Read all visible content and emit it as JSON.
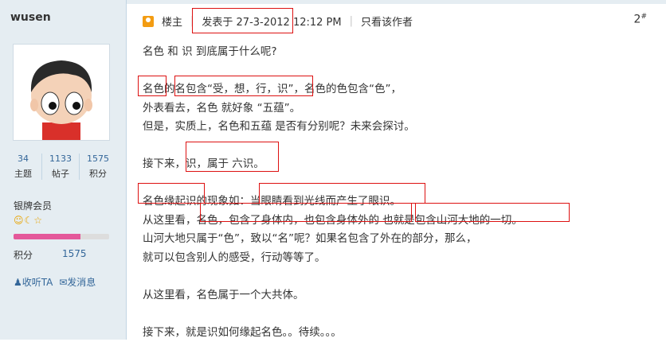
{
  "user": {
    "name": "wusen",
    "stats": [
      {
        "value": "34",
        "label": "主题"
      },
      {
        "value": "1133",
        "label": "帖子"
      },
      {
        "value": "1575",
        "label": "积分"
      }
    ],
    "rank": "银牌会员",
    "rank_level_fraction": 0.7,
    "score_label": "积分",
    "score_value": "1575",
    "actions": {
      "follow": "收听TA",
      "message": "发消息"
    }
  },
  "post": {
    "author_tag": "楼主",
    "posted": "发表于 27-3-2012 12:12 PM",
    "only_author": "只看该作者",
    "floor": "2",
    "floor_mark": "#",
    "lines": [
      [
        "名色 和 识 到底属于什么呢?"
      ],
      [
        ""
      ],
      [
        "名色",
        "的",
        "名包含“受，想，行，识”",
        "，名色的色包含“色”，"
      ],
      [
        "外表看去，名色 就好象 “五蕴”。"
      ],
      [
        "但是，实质上，名色和五蕴 是否有分别呢？未来会探讨。"
      ],
      [
        ""
      ],
      [
        "接下来",
        "，识，属于 六识。"
      ],
      [
        ""
      ],
      [
        "名色缘起识",
        "的现象如：",
        "当眼睛看到光线而产生了眼识。"
      ],
      [
        "从这里看，",
        "名色，包含了身体内，也包含身体外的",
        " ",
        "也就是包含山河大地的一切。"
      ],
      [
        "山河大地只属于“色”，致以“名”呢？如果名包含了外在的部分，那么，"
      ],
      [
        "就可以包含别人的感受，行动等等了。"
      ],
      [
        ""
      ],
      [
        "从这里看，名色属于一个大共体。"
      ],
      [
        ""
      ],
      [
        "接下来，就是识如何缘起名色。。待续。。。"
      ]
    ]
  }
}
